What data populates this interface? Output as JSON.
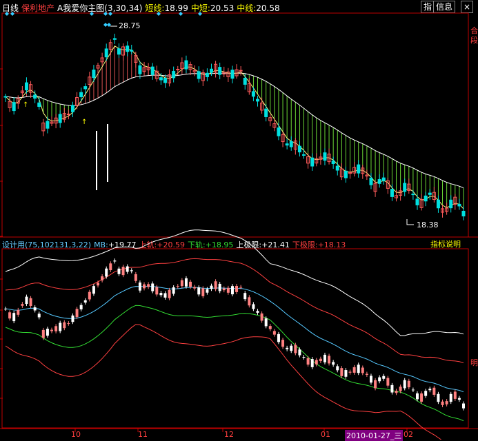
{
  "header": {
    "period": "日线",
    "stock_name": "保利地产",
    "indicator_name": "A我爱你主图",
    "indicator_params": "(3,30,34)",
    "short_label": "短线:",
    "short_value": "18.99",
    "mid_short_label": "中短:",
    "mid_short_value": "20.53",
    "mid_label": "中线:",
    "mid_value": "20.58"
  },
  "toolbar": {
    "indicator_btn": "指",
    "info_btn": "信息"
  },
  "right_strip": {
    "labels": [
      "合",
      "段"
    ],
    "bottom_label": "明"
  },
  "upper": {
    "high_label": "28.75",
    "low_label": "18.38"
  },
  "lower": {
    "name": "设计用",
    "params": "(75,102131,3,22)",
    "mb_label": "MB:",
    "mb_value": "+19.77",
    "upper_label": "上轨:",
    "upper_value": "+20.59",
    "lower_label": "下轨:",
    "lower_value": "+18.95",
    "top_limit_label": "上极限:",
    "top_limit_value": "+21.41",
    "bottom_limit_label": "下极限:",
    "bottom_limit_value": "+18.13",
    "explain_btn": "指标说明"
  },
  "xaxis": {
    "labels": [
      "10",
      "11",
      "12",
      "01",
      "2010-01-27_三",
      "02"
    ]
  },
  "colors": {
    "up": "#ff5a5a",
    "down": "#00e0e0",
    "cyan": "#55c8ff",
    "green": "#33dd33",
    "yellow": "#ffff00",
    "red": "#ff3030",
    "white": "#ffffff",
    "axis": "#c00000"
  }
}
